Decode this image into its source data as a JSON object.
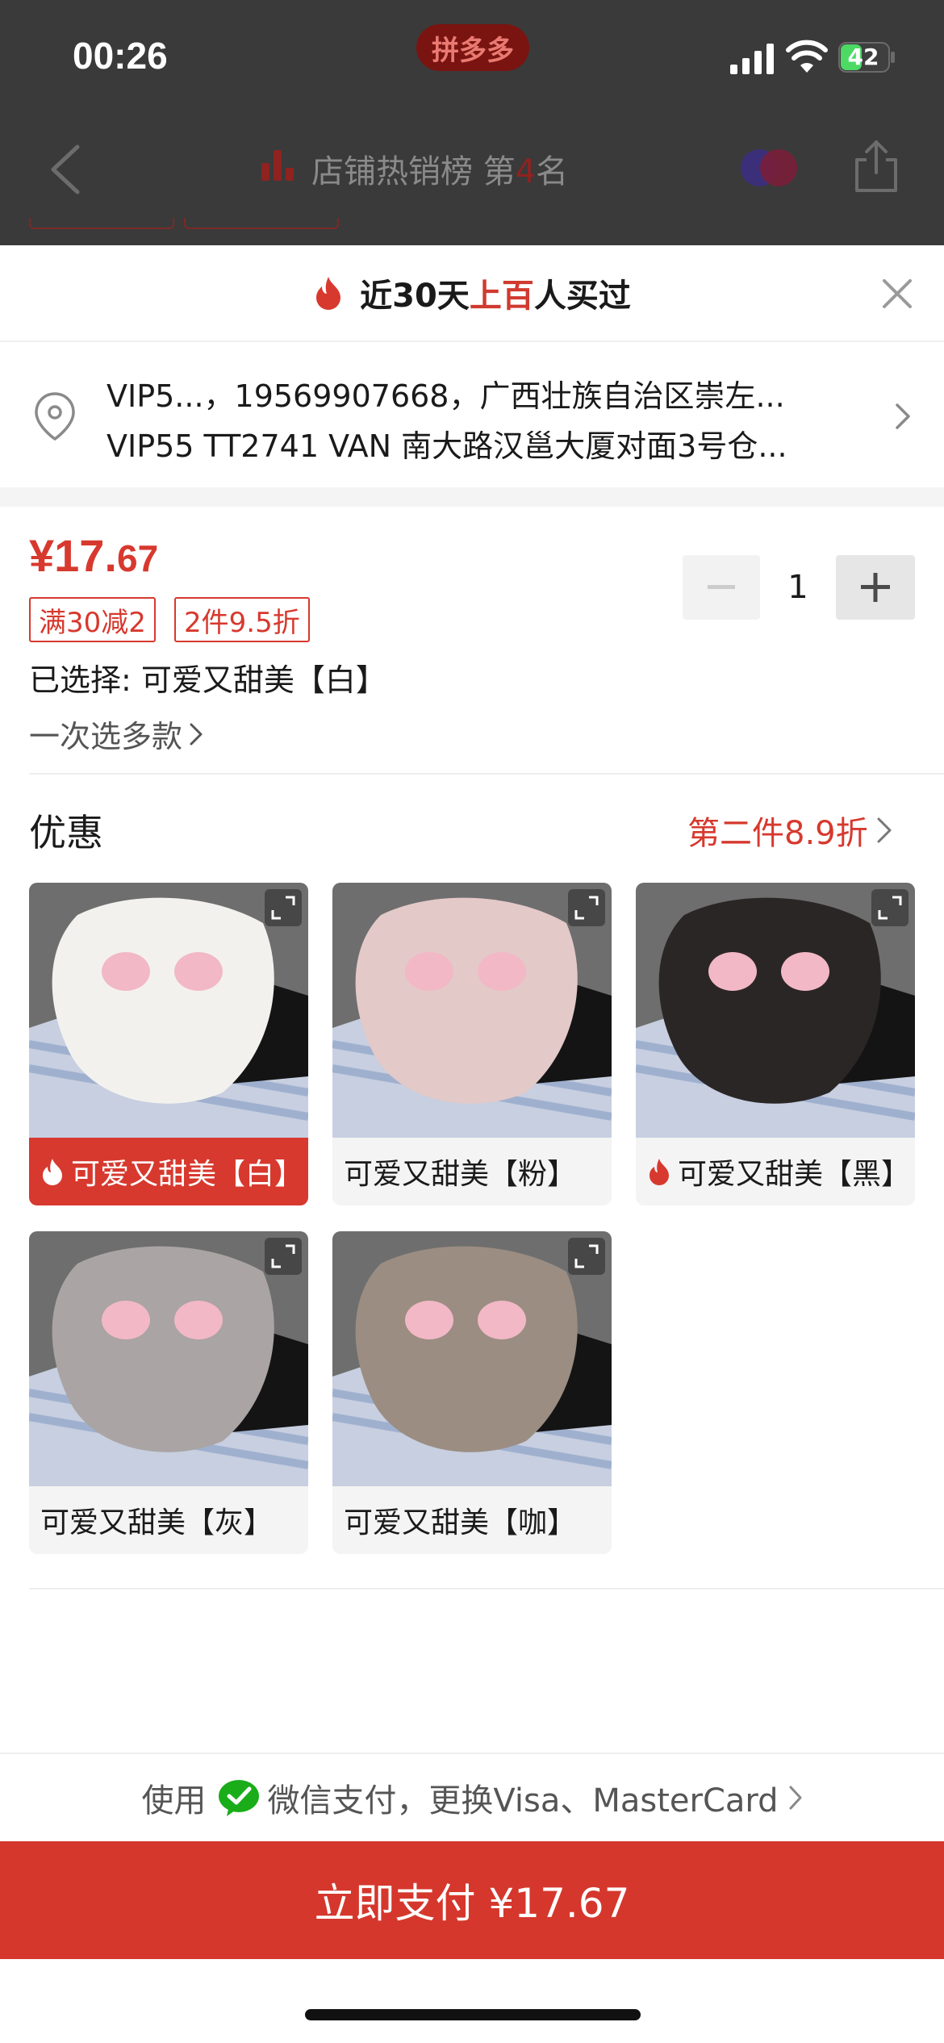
{
  "status_bar": {
    "time": "00:26",
    "brand": "拼多多",
    "battery": "42"
  },
  "background_nav": {
    "rank_prefix": "店铺热销榜 第",
    "rank_number": "4",
    "rank_suffix": "名"
  },
  "sheet": {
    "title_prefix": "近30天",
    "title_highlight": "上百",
    "title_suffix": "人买过"
  },
  "address": {
    "line1": "VIP5...，19569907668，广西壮族自治区崇左...",
    "line2": "VIP55 TT2741 VAN  南大路汉邕大厦对面3号仓..."
  },
  "product": {
    "price_main": "¥17.",
    "price_cents": "67",
    "quantity": "1",
    "tags": [
      "满30减2",
      "2件9.5折"
    ],
    "selected": "已选择: 可爱又甜美【白】",
    "multi_select": "一次选多款"
  },
  "offers": {
    "title": "优惠",
    "link": "第二件8.9折"
  },
  "variants": [
    {
      "label": "可爱又甜美【白】",
      "selected": true,
      "hot": true,
      "color": "#f3f1ee"
    },
    {
      "label": "可爱又甜美【粉】",
      "selected": false,
      "hot": false,
      "color": "#e3c9c8"
    },
    {
      "label": "可爱又甜美【黑】",
      "selected": false,
      "hot": true,
      "color": "#2b2626"
    },
    {
      "label": "可爱又甜美【灰】",
      "selected": false,
      "hot": false,
      "color": "#aaa4a4"
    },
    {
      "label": "可爱又甜美【咖】",
      "selected": false,
      "hot": false,
      "color": "#9b8d82"
    }
  ],
  "payment": {
    "prefix": "使用",
    "text": "微信支付，更换Visa、MasterCard",
    "button": "立即支付 ¥17.67"
  },
  "colors": {
    "accent": "#d7392e",
    "dim_overlay": "#3a3a3a"
  }
}
